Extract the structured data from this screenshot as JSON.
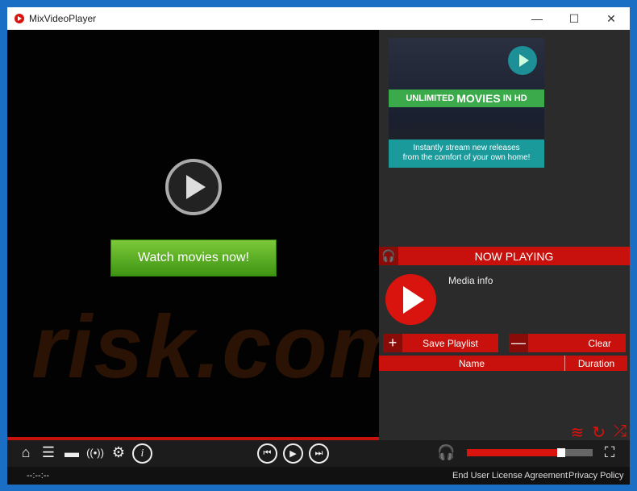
{
  "window": {
    "title": "MixVideoPlayer",
    "minimize": "—",
    "maximize": "☐",
    "close": "✕"
  },
  "video": {
    "cta": "Watch movies now!",
    "watermark": "risk.com"
  },
  "ad": {
    "headline_pre": "UNLIMITED",
    "headline_main": "MOVIES",
    "headline_post": "IN HD",
    "line1": "Instantly stream new releases",
    "line2": "from the comfort of your own home!"
  },
  "now_playing": {
    "title": "NOW PLAYING",
    "media_info": "Media info"
  },
  "playlist": {
    "add": "+",
    "save": "Save Playlist",
    "remove": "—",
    "clear": "Clear",
    "columns": [
      "Name",
      "Duration"
    ]
  },
  "player": {
    "volume_percent": 75,
    "time": "--:--:--"
  },
  "footer": {
    "eula": "End User License Agreement",
    "privacy": "Privacy Policy"
  },
  "colors": {
    "accent": "#c8110c",
    "border": "#1a6fc4"
  }
}
